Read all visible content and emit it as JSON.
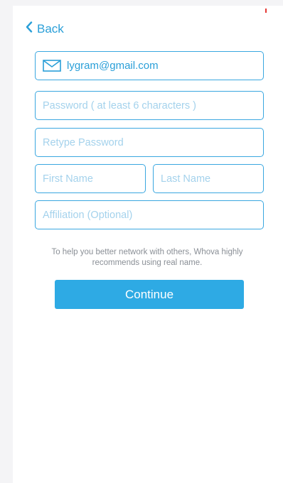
{
  "nav": {
    "back_label": "Back"
  },
  "form": {
    "email": {
      "value": "lygram@gmail.com"
    },
    "password": {
      "placeholder": "Password ( at least 6 characters )"
    },
    "retype_password": {
      "placeholder": "Retype Password"
    },
    "first_name": {
      "placeholder": "First Name"
    },
    "last_name": {
      "placeholder": "Last Name"
    },
    "affiliation": {
      "placeholder": "Affiliation (Optional)"
    }
  },
  "note": "To help you better network with others, Whova highly recommends using real name.",
  "continue_label": "Continue",
  "icons": {
    "back": "chevron-left-icon",
    "email": "envelope-icon"
  },
  "colors": {
    "accent": "#2a9fd8",
    "button": "#2eaae4",
    "placeholder": "#a4d2ec",
    "note": "#8a8f96"
  }
}
